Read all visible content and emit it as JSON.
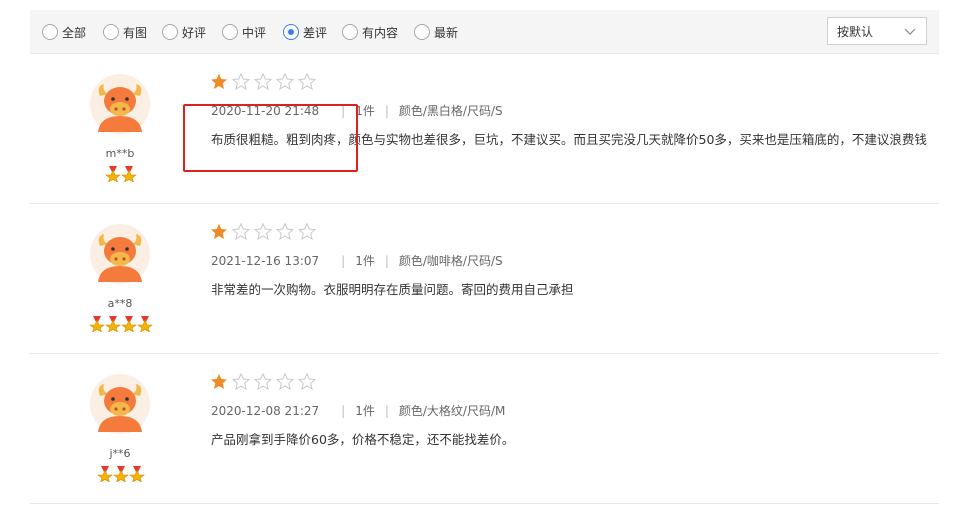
{
  "filters": {
    "options": [
      {
        "label": "全部",
        "checked": false
      },
      {
        "label": "有图",
        "checked": false
      },
      {
        "label": "好评",
        "checked": false
      },
      {
        "label": "中评",
        "checked": false
      },
      {
        "label": "差评",
        "checked": true
      },
      {
        "label": "有内容",
        "checked": false
      },
      {
        "label": "最新",
        "checked": false
      }
    ]
  },
  "sort": {
    "label": "按默认",
    "icon": "chevron-down-icon"
  },
  "reviews": [
    {
      "username": "m**b",
      "medal_count": 2,
      "rating": 1,
      "max_rating": 5,
      "date": "2020-11-20 21:48",
      "quantity": "1件",
      "variant": "颜色/黑白格/尺码/S",
      "content": "布质很粗糙。粗到肉疼，颜色与实物也差很多，巨坑，不建议买。而且买完没几天就降价50多，买来也是压箱底的，不建议浪费钱"
    },
    {
      "username": "a**8",
      "medal_count": 4,
      "rating": 1,
      "max_rating": 5,
      "date": "2021-12-16 13:07",
      "quantity": "1件",
      "variant": "颜色/咖啡格/尺码/S",
      "content": "非常差的一次购物。衣服明明存在质量问题。寄回的费用自己承担"
    },
    {
      "username": "j**6",
      "medal_count": 3,
      "rating": 1,
      "max_rating": 5,
      "date": "2020-12-08 21:27",
      "quantity": "1件",
      "variant": "颜色/大格纹/尺码/M",
      "content": "产品刚拿到手降价60多，价格不稳定，还不能找差价。"
    }
  ],
  "colors": {
    "accent": "#3a7bf0",
    "star_filled": "#f08a24",
    "star_empty": "#cccccc",
    "avatar_orange": "#f57b3d",
    "highlight_red": "#e0201a"
  }
}
